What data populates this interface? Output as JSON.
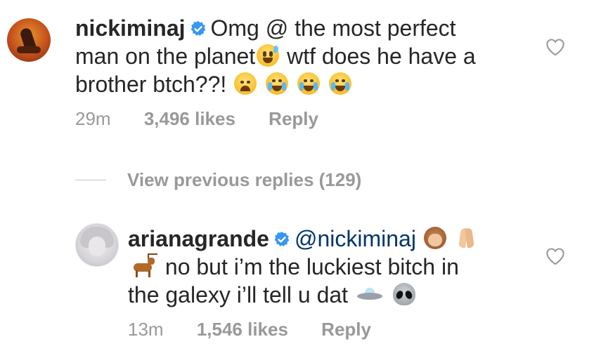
{
  "comments": [
    {
      "username": "nickiminaj",
      "text_line1": "Omg @ the most perfect",
      "text_line2a": "man on the planet",
      "text_line2b": "wtf does he have a",
      "text_line3": "brother btch??!",
      "time": "29m",
      "likes": "3,496 likes",
      "reply_label": "Reply"
    },
    {
      "username": "arianagrande",
      "mention": "@nickiminaj",
      "text_line2": "no but i’m the luckiest bitch in",
      "text_line3": "the galexy i’ll tell u dat",
      "time": "13m",
      "likes": "1,546 likes",
      "reply_label": "Reply"
    }
  ],
  "view_previous": "View previous replies (129)",
  "icons": {
    "verified": "verified-badge-icon",
    "like": "heart-outline-icon"
  },
  "colors": {
    "verified": "#3897f0",
    "meta": "#999999",
    "text": "#262626"
  }
}
